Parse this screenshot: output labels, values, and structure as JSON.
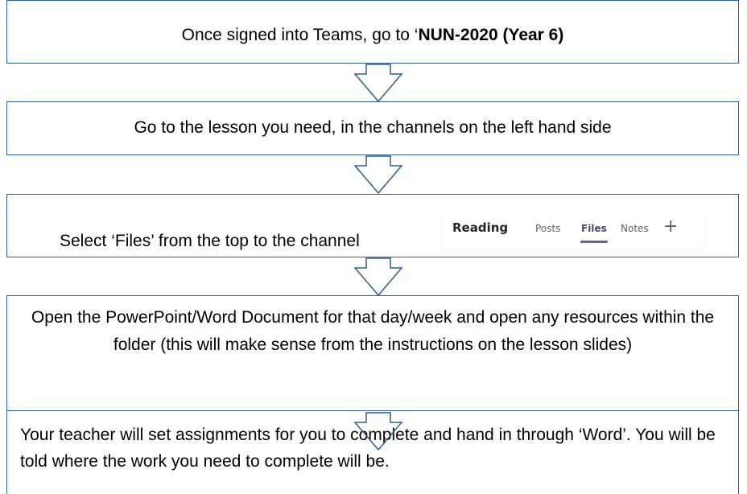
{
  "steps": [
    {
      "prefix": "Once signed into Teams, go to ‘",
      "bold": "NUN-2020 (Year 6)"
    },
    {
      "text": "Go to the lesson you need, in the channels on the left hand side"
    },
    {
      "text": "Select ‘Files’ from the top to the channel"
    },
    {
      "text": "Open the PowerPoint/Word Document for that day/week and open any resources within the folder (this will make sense from the instructions on the lesson slides)"
    },
    {
      "text": "Your teacher will set assignments for you to complete and hand in through ‘Word’. You will be told where the work you need to complete will be."
    }
  ],
  "tab_strip": {
    "channel_name": "Reading",
    "tabs": [
      "Posts",
      "Files",
      "Notes"
    ],
    "active_tab": "Files",
    "add_tab_icon": "plus-icon"
  },
  "colors": {
    "box_border": "#2e5f8f",
    "active_tab_underline": "#6264a7"
  }
}
